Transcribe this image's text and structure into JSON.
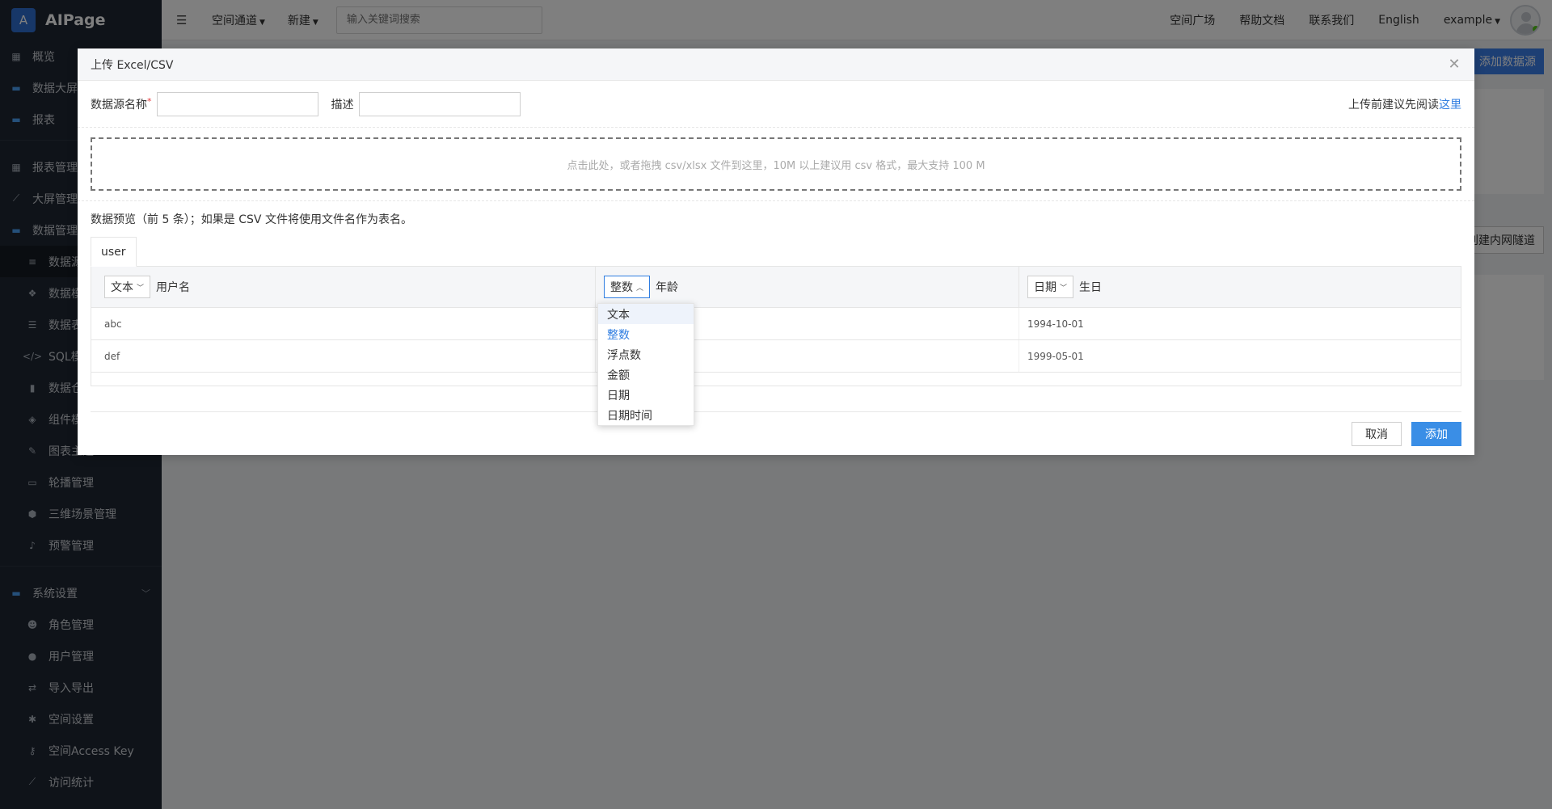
{
  "app": {
    "logo_letter": "A",
    "name": "AIPage"
  },
  "sidebar": {
    "items": [
      {
        "label": "概览",
        "kind": "top",
        "icon": "dashboard-icon"
      },
      {
        "label": "数据大屏",
        "kind": "folder",
        "icon": "folder-icon"
      },
      {
        "label": "报表",
        "kind": "folder",
        "icon": "folder-icon"
      },
      {
        "label": "报表管理",
        "kind": "top",
        "icon": "grid-icon"
      },
      {
        "label": "大屏管理",
        "kind": "top",
        "icon": "chart-line-icon"
      },
      {
        "label": "数据管理",
        "kind": "folder",
        "icon": "folder-icon"
      },
      {
        "label": "数据源",
        "kind": "sub",
        "icon": "database-icon"
      },
      {
        "label": "数据模型",
        "kind": "sub",
        "icon": "cubes-icon"
      },
      {
        "label": "数据表",
        "kind": "sub",
        "icon": "list-icon"
      },
      {
        "label": "SQL模板",
        "kind": "sub",
        "icon": "code-icon"
      },
      {
        "label": "数据仓库",
        "kind": "sub",
        "icon": "book-icon"
      },
      {
        "label": "组件模板",
        "kind": "sub",
        "icon": "cube-icon"
      },
      {
        "label": "图表主题",
        "kind": "sub",
        "icon": "paint-icon"
      },
      {
        "label": "轮播管理",
        "kind": "sub",
        "icon": "monitor-icon"
      },
      {
        "label": "三维场景管理",
        "kind": "sub",
        "icon": "box-icon"
      },
      {
        "label": "预警管理",
        "kind": "sub",
        "icon": "bell-icon"
      },
      {
        "label": "系统设置",
        "kind": "folder",
        "icon": "folder-icon"
      },
      {
        "label": "角色管理",
        "kind": "sub",
        "icon": "users-icon"
      },
      {
        "label": "用户管理",
        "kind": "sub",
        "icon": "user-icon"
      },
      {
        "label": "导入导出",
        "kind": "sub",
        "icon": "exchange-icon"
      },
      {
        "label": "空间设置",
        "kind": "sub",
        "icon": "gear-icon"
      },
      {
        "label": "空间Access Key",
        "kind": "sub",
        "icon": "key-icon"
      },
      {
        "label": "访问统计",
        "kind": "sub",
        "icon": "stats-icon"
      }
    ]
  },
  "header": {
    "channel": "空间通道",
    "new": "新建",
    "search_placeholder": "输入关键词搜索",
    "square": "空间广场",
    "help": "帮助文档",
    "contact": "联系我们",
    "lang": "English",
    "user": "example"
  },
  "background": {
    "add_datasource": "添加数据源",
    "tunnel": "创建内网隧道"
  },
  "modal": {
    "title": "上传 Excel/CSV",
    "name_label": "数据源名称",
    "name_required": "*",
    "desc_label": "描述",
    "hint_text": "上传前建议先阅读",
    "hint_link": "这里",
    "dropzone": "点击此处，或者拖拽 csv/xlsx 文件到这里，10M 以上建议用 csv 格式，最大支持 100 M",
    "preview_note": "数据预览（前 5 条）；如果是 CSV 文件将使用文件名作为表名。",
    "tab": "user",
    "columns": [
      {
        "type": "文本",
        "name": "用户名"
      },
      {
        "type": "整数",
        "name": "年龄"
      },
      {
        "type": "日期",
        "name": "生日"
      }
    ],
    "rows": [
      [
        "abc",
        "",
        "1994-10-01"
      ],
      [
        "def",
        "",
        "1999-05-01"
      ]
    ],
    "cancel": "取消",
    "add": "添加"
  },
  "dropdown": {
    "options": [
      "文本",
      "整数",
      "浮点数",
      "金额",
      "日期",
      "日期时间"
    ],
    "selected": "整数",
    "hovered": "文本"
  }
}
